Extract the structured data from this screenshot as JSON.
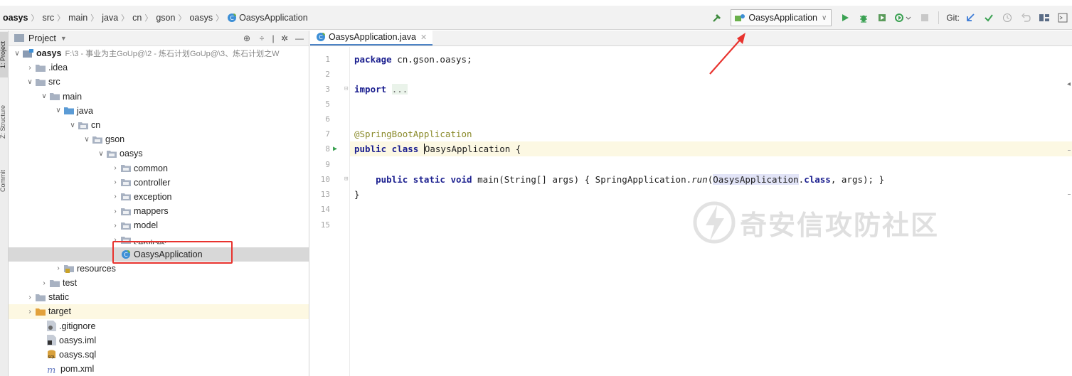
{
  "navbar": {
    "breadcrumbs": [
      "oasys",
      "src",
      "main",
      "java",
      "cn",
      "gson",
      "oasys",
      "OasysApplication"
    ],
    "run_configuration": "OasysApplication",
    "git_label": "Git:"
  },
  "toolstrip": {
    "tabs": [
      "1: Project",
      "Z: Structure",
      "Commit"
    ]
  },
  "project_panel": {
    "title": "Project",
    "tree": [
      {
        "label": "oasys",
        "path": "F:\\3 - 事业为主GoUp@\\2 - 炼石计划GoUp@\\3、炼石计划之W"
      },
      {
        "label": ".idea"
      },
      {
        "label": "src"
      },
      {
        "label": "main"
      },
      {
        "label": "java"
      },
      {
        "label": "cn"
      },
      {
        "label": "gson"
      },
      {
        "label": "oasys"
      },
      {
        "label": "common"
      },
      {
        "label": "controller"
      },
      {
        "label": "exception"
      },
      {
        "label": "mappers"
      },
      {
        "label": "model"
      },
      {
        "label": "services"
      },
      {
        "label": "OasysApplication"
      },
      {
        "label": "resources"
      },
      {
        "label": "test"
      },
      {
        "label": "static"
      },
      {
        "label": "target"
      },
      {
        "label": ".gitignore"
      },
      {
        "label": "oasys.iml"
      },
      {
        "label": "oasys.sql"
      },
      {
        "label": "pom.xml"
      }
    ]
  },
  "editor": {
    "tab": "OasysApplication.java",
    "line_numbers": [
      "1",
      "2",
      "3",
      "5",
      "6",
      "7",
      "8",
      "9",
      "10",
      "13",
      "14",
      "15"
    ],
    "code": {
      "l1_kw": "package",
      "l1_rest": " cn.gson.oasys;",
      "l3_kw": "import",
      "l3_folded": "...",
      "l7_ann": "@SpringBootApplication",
      "l8_kw": "public class",
      "l8_sp": " ",
      "l8_class": "OasysApplication",
      "l8_rest": " {",
      "l10_indent": "    ",
      "l10_kw": "public static void",
      "l10_a": " main(String[] args) { SpringApplication.",
      "l10_run": "run",
      "l10_b": "(",
      "l10_ref": "OasysApplication",
      "l10_c": ".",
      "l10_cls": "class",
      "l10_d": ", args); }",
      "l13": "}"
    },
    "watermark": "奇安信攻防社区"
  },
  "colors": {
    "keyword": "#1b1f8f",
    "annotation": "#8a8a2a",
    "highlight_box": "#e8332e",
    "run_green": "#3aa152"
  }
}
